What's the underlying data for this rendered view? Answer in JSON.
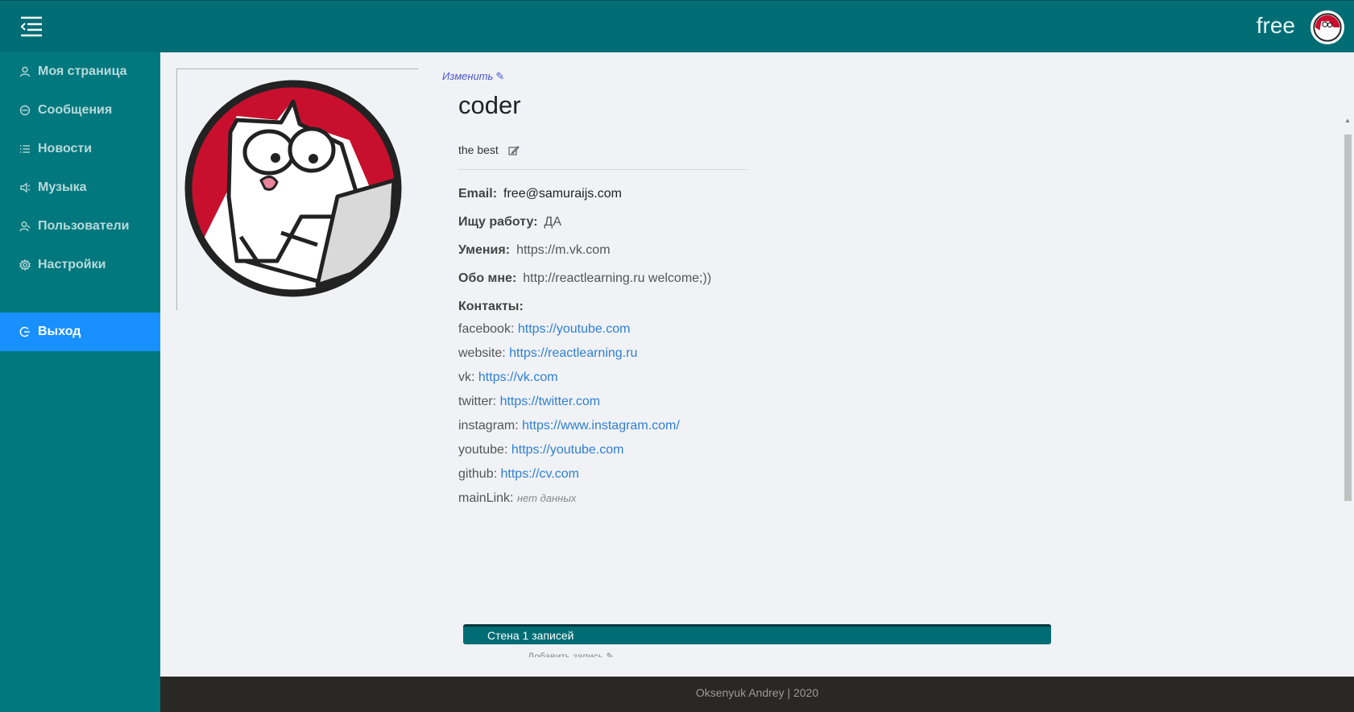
{
  "header": {
    "login": "free"
  },
  "sidebar": {
    "items": [
      {
        "label": "Моя страница",
        "icon": "user-icon"
      },
      {
        "label": "Сообщения",
        "icon": "message-icon"
      },
      {
        "label": "Новости",
        "icon": "list-icon"
      },
      {
        "label": "Музыка",
        "icon": "sound-icon"
      },
      {
        "label": "Пользователи",
        "icon": "users-icon"
      },
      {
        "label": "Настройки",
        "icon": "gear-icon"
      }
    ],
    "logout": {
      "label": "Выход",
      "icon": "logout-icon"
    }
  },
  "profile": {
    "edit_label": "Изменить",
    "full_name": "coder",
    "status": "the best",
    "email_label": "Email:",
    "email": "free@samuraijs.com",
    "job_label": "Ищу работу:",
    "job_value": "ДА",
    "skills_label": "Умения:",
    "skills_value": "https://m.vk.com",
    "about_label": "Обо мне:",
    "about_value": "http://reactlearning.ru welcome;))",
    "contacts_label": "Контакты:",
    "contacts": [
      {
        "name": "facebook:",
        "value": "https://youtube.com"
      },
      {
        "name": "website:",
        "value": "https://reactlearning.ru"
      },
      {
        "name": "vk:",
        "value": "https://vk.com"
      },
      {
        "name": "twitter:",
        "value": "https://twitter.com"
      },
      {
        "name": "instagram:",
        "value": "https://www.instagram.com/"
      },
      {
        "name": "youtube:",
        "value": "https://youtube.com"
      },
      {
        "name": "github:",
        "value": "https://cv.com"
      }
    ],
    "main_link_label": "mainLink:",
    "main_link_value": "нет данных"
  },
  "wall": {
    "title": "Стена 1 записей",
    "add_post": "Добавить запись ✎"
  },
  "footer": {
    "text": "Oksenyuk Andrey | 2020"
  },
  "colors": {
    "header": "#006d75",
    "sidebar": "#00787d",
    "active": "#1890ff",
    "link": "#2f7fd6",
    "footer": "#2a2825"
  }
}
